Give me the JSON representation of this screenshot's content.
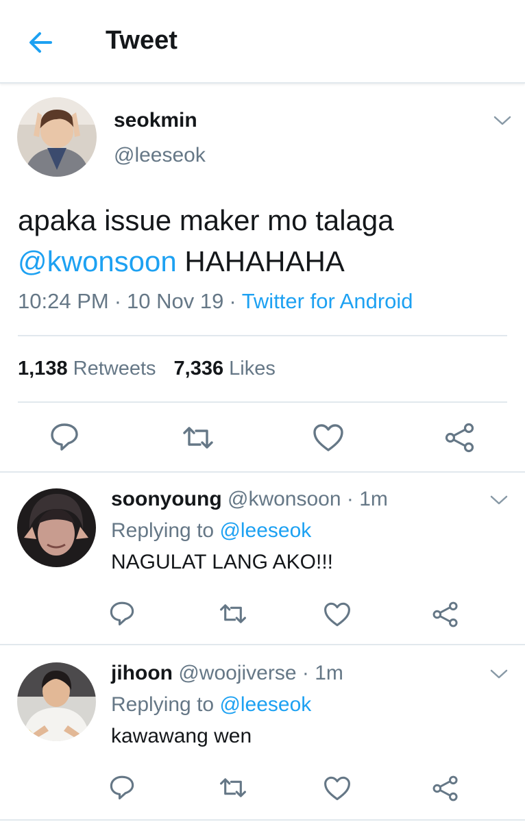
{
  "header": {
    "title": "Tweet"
  },
  "tweet": {
    "display_name": "seokmin",
    "handle": "@leeseok",
    "text_line1": "apaka issue maker mo talaga",
    "mention": "@kwonsoon",
    "text_rest": " HAHAHAHA",
    "time": "10:24 PM",
    "date": "10 Nov 19",
    "source": "Twitter for Android",
    "meta_sep": "·",
    "retweets_count": "1,138",
    "retweets_label": "Retweets",
    "likes_count": "7,336",
    "likes_label": "Likes"
  },
  "replies": [
    {
      "display_name": "soonyoung",
      "handle": "@kwonsoon",
      "sep": "·",
      "time": "1m",
      "replying_prefix": "Replying to ",
      "replying_to": "@leeseok",
      "text": "NAGULAT LANG AKO!!!"
    },
    {
      "display_name": "jihoon",
      "handle": "@woojiverse",
      "sep": "·",
      "time": "1m",
      "replying_prefix": "Replying to ",
      "replying_to": "@leeseok",
      "text": "kawawang wen"
    }
  ],
  "colors": {
    "accent": "#1da1f2",
    "secondary_text": "#657786",
    "primary_text": "#14171a",
    "divider": "#e1e8ed"
  },
  "icons": [
    "back-arrow-icon",
    "chevron-down-icon",
    "reply-icon",
    "retweet-icon",
    "like-icon",
    "share-icon"
  ]
}
